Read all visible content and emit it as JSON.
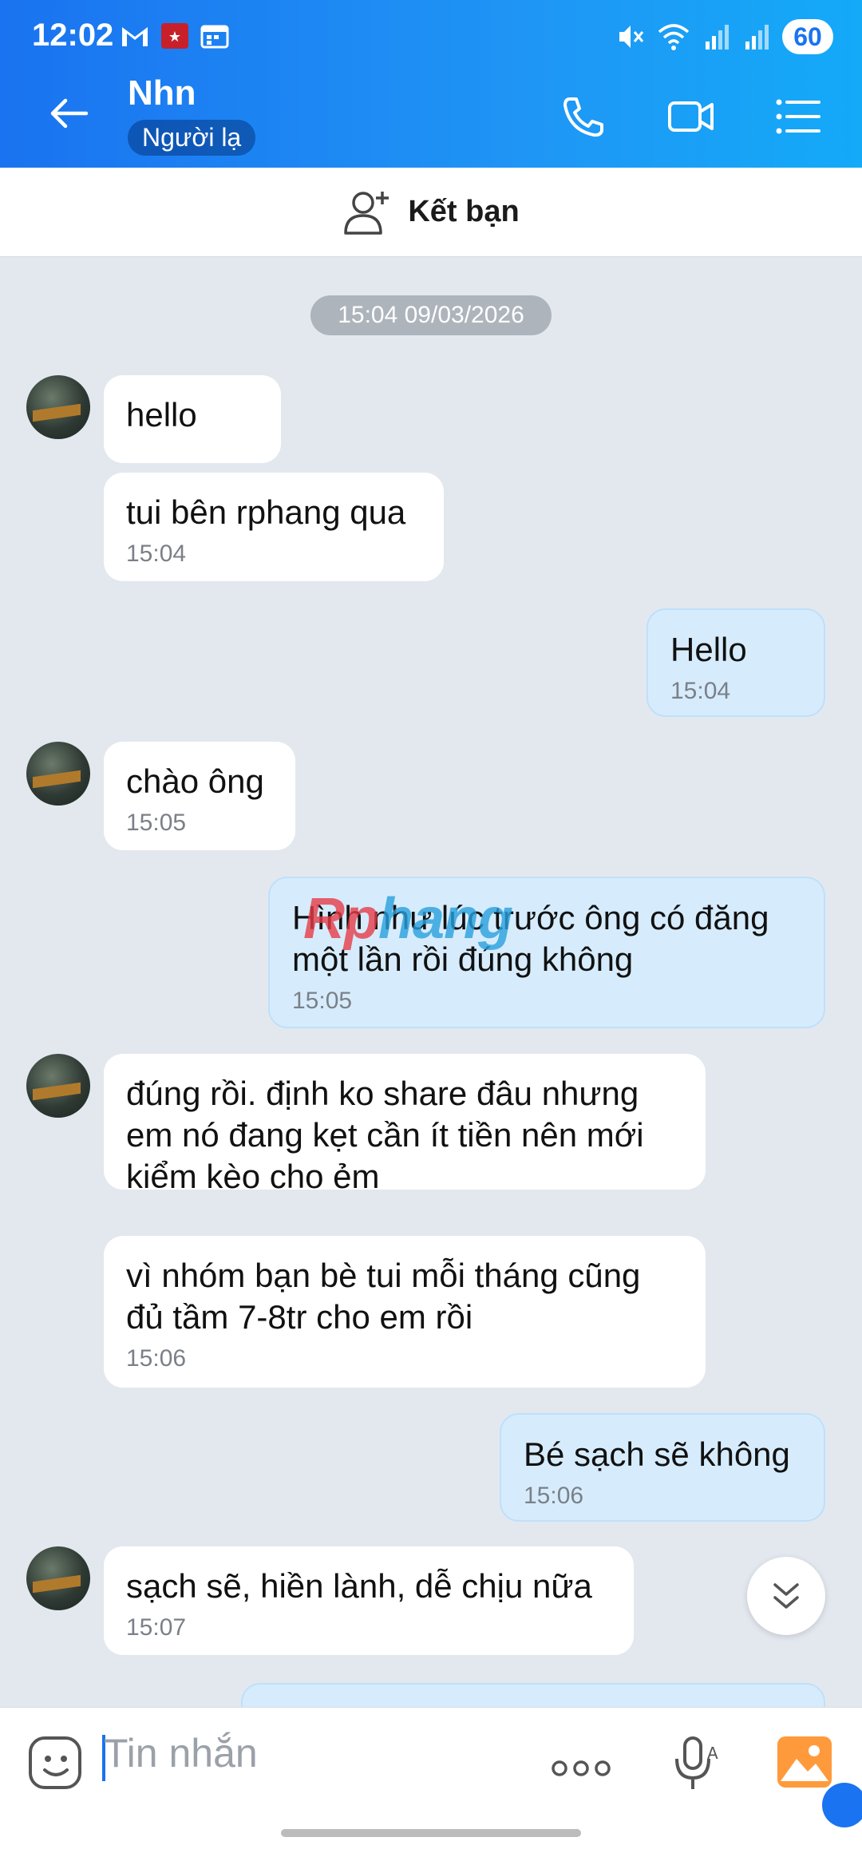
{
  "status": {
    "time": "12:02",
    "battery": "60"
  },
  "header": {
    "name": "Nhn",
    "badge": "Người lạ"
  },
  "friend_bar": {
    "label": "Kết bạn"
  },
  "date_pill": "15:04 09/03/2026",
  "messages": [
    {
      "text": "hello"
    },
    {
      "text": "tui bên rphang qua",
      "time": "15:04"
    },
    {
      "text": "Hello",
      "time": "15:04"
    },
    {
      "text": "chào ông",
      "time": "15:05"
    },
    {
      "text": "Hình như lúc trước ông có đăng một lần rồi đúng không",
      "time": "15:05"
    },
    {
      "text": "đúng rồi. định ko share đâu nhưng em nó đang kẹt cần ít tiền nên mới kiểm kèo cho ẻm"
    },
    {
      "text": "vì nhóm bạn bè tui mỗi tháng cũng đủ tầm 7-8tr cho em rồi",
      "time": "15:06"
    },
    {
      "text": "Bé sạch sẽ không",
      "time": "15:06"
    },
    {
      "text": "sạch sẽ, hiền lành, dễ chịu nữa",
      "time": "15:07"
    }
  ],
  "watermark": {
    "a": "Rp",
    "b": "hang"
  },
  "input": {
    "placeholder": "Tin nhắn"
  },
  "icons": [
    "back-arrow-icon",
    "phone-icon",
    "video-call-icon",
    "menu-list-icon",
    "add-friend-icon",
    "chevrons-down-icon",
    "emoji-icon",
    "more-dots-icon",
    "microphone-icon",
    "gallery-icon"
  ],
  "colors": {
    "header_start": "#1a73f0",
    "header_end": "#14aaf8",
    "out_bubble": "#d6ecfd",
    "in_bubble": "#ffffff",
    "background": "#e3e8ef"
  }
}
